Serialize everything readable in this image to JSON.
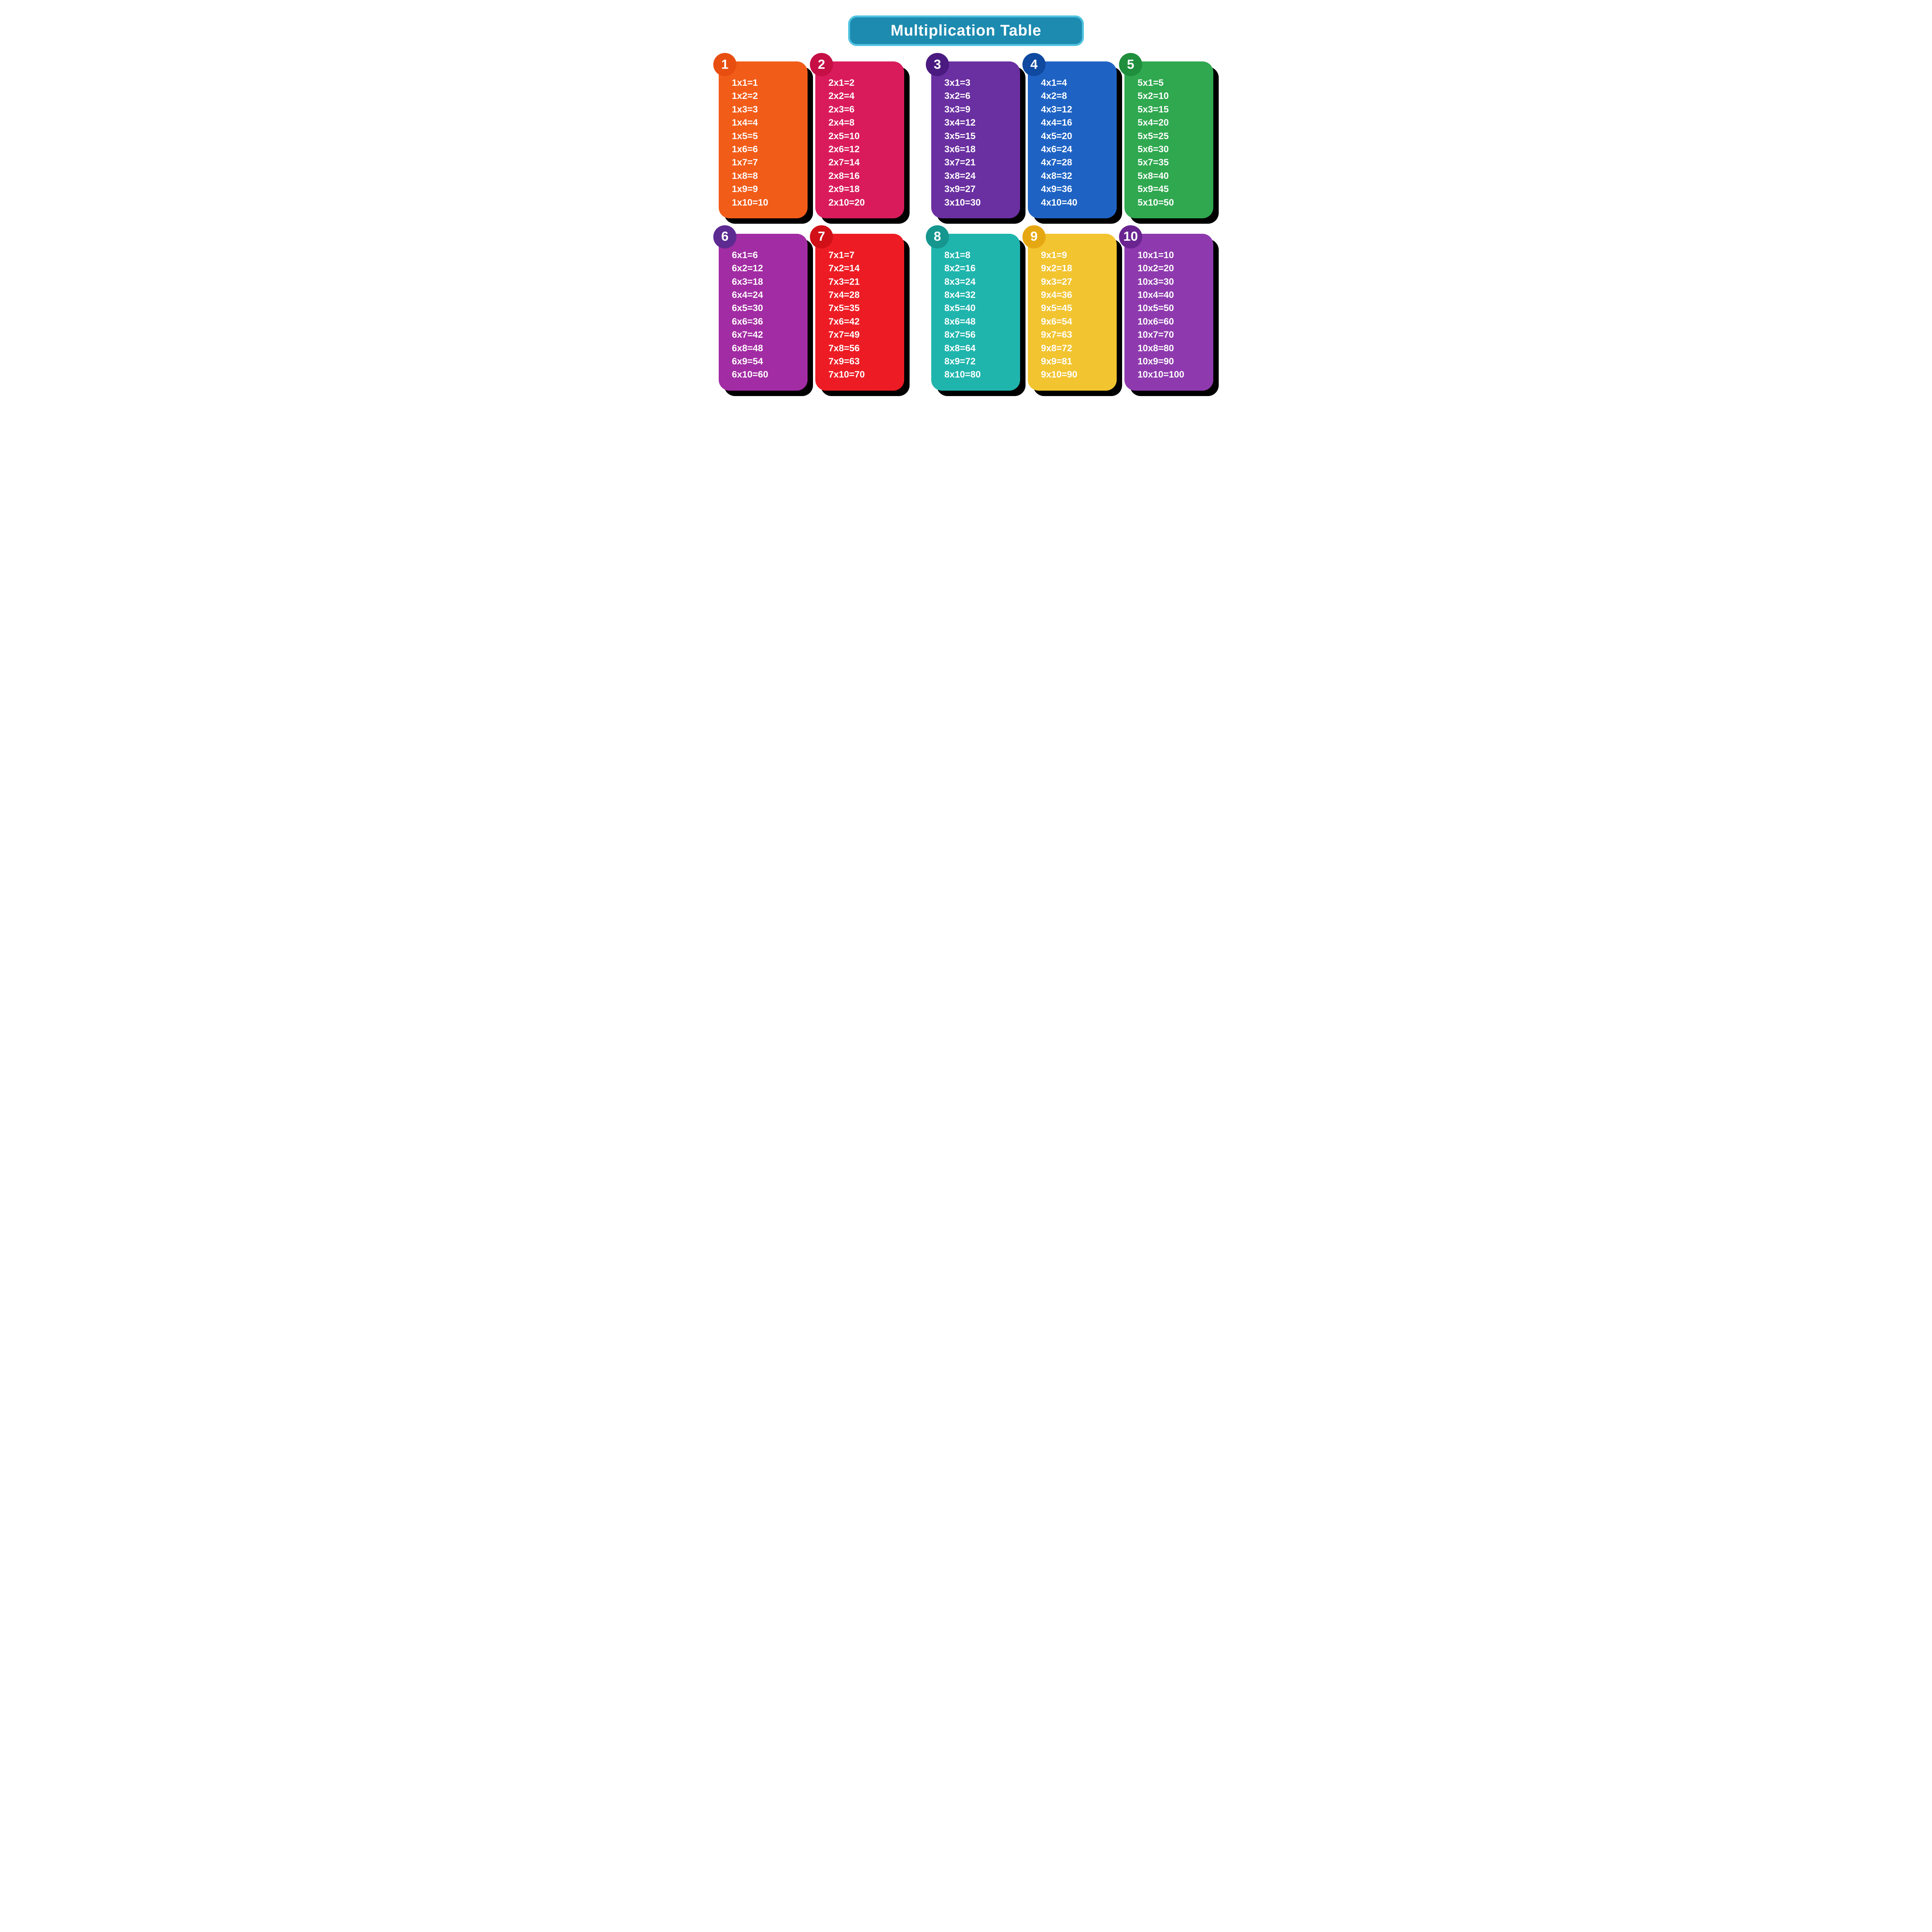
{
  "title": "Multiplication Table",
  "tables": [
    {
      "number": "1",
      "card_color": "#f25c19",
      "badge_color": "#e84e10",
      "lines": [
        "1x1=1",
        "1x2=2",
        "1x3=3",
        "1x4=4",
        "1x5=5",
        "1x6=6",
        "1x7=7",
        "1x8=8",
        "1x9=9",
        "1x10=10"
      ]
    },
    {
      "number": "2",
      "card_color": "#d91b5c",
      "badge_color": "#c50f45",
      "lines": [
        "2x1=2",
        "2x2=4",
        "2x3=6",
        "2x4=8",
        "2x5=10",
        "2x6=12",
        "2x7=14",
        "2x8=16",
        "2x9=18",
        "2x10=20"
      ]
    },
    {
      "number": "3",
      "card_color": "#6a2fa0",
      "badge_color": "#4a1a80",
      "lines": [
        "3x1=3",
        "3x2=6",
        "3x3=9",
        "3x4=12",
        "3x5=15",
        "3x6=18",
        "3x7=21",
        "3x8=24",
        "3x9=27",
        "3x10=30"
      ]
    },
    {
      "number": "4",
      "card_color": "#1e63c4",
      "badge_color": "#0f4aa0",
      "lines": [
        "4x1=4",
        "4x2=8",
        "4x3=12",
        "4x4=16",
        "4x5=20",
        "4x6=24",
        "4x7=28",
        "4x8=32",
        "4x9=36",
        "4x10=40"
      ]
    },
    {
      "number": "5",
      "card_color": "#2fa84f",
      "badge_color": "#1f8f3d",
      "lines": [
        "5x1=5",
        "5x2=10",
        "5x3=15",
        "5x4=20",
        "5x5=25",
        "5x6=30",
        "5x7=35",
        "5x8=40",
        "5x9=45",
        "5x10=50"
      ]
    },
    {
      "number": "6",
      "card_color": "#a22ca3",
      "badge_color": "#5d2a92",
      "lines": [
        "6x1=6",
        "6x2=12",
        "6x3=18",
        "6x4=24",
        "6x5=30",
        "6x6=36",
        "6x7=42",
        "6x8=48",
        "6x9=54",
        "6x10=60"
      ]
    },
    {
      "number": "7",
      "card_color": "#ed1c24",
      "badge_color": "#d11018",
      "lines": [
        "7x1=7",
        "7x2=14",
        "7x3=21",
        "7x4=28",
        "7x5=35",
        "7x6=42",
        "7x7=49",
        "7x8=56",
        "7x9=63",
        "7x10=70"
      ]
    },
    {
      "number": "8",
      "card_color": "#1fb5ad",
      "badge_color": "#15968f",
      "lines": [
        "8x1=8",
        "8x2=16",
        "8x3=24",
        "8x4=32",
        "8x5=40",
        "8x6=48",
        "8x7=56",
        "8x8=64",
        "8x9=72",
        "8x10=80"
      ]
    },
    {
      "number": "9",
      "card_color": "#f2c430",
      "badge_color": "#e6a812",
      "lines": [
        "9x1=9",
        "9x2=18",
        "9x3=27",
        "9x4=36",
        "9x5=45",
        "9x6=54",
        "9x7=63",
        "9x8=72",
        "9x9=81",
        "9x10=90"
      ]
    },
    {
      "number": "10",
      "card_color": "#8e3aae",
      "badge_color": "#6a2490",
      "lines": [
        "10x1=10",
        "10x2=20",
        "10x3=30",
        "10x4=40",
        "10x5=50",
        "10x6=60",
        "10x7=70",
        "10x8=80",
        "10x9=90",
        "10x10=100"
      ]
    }
  ]
}
